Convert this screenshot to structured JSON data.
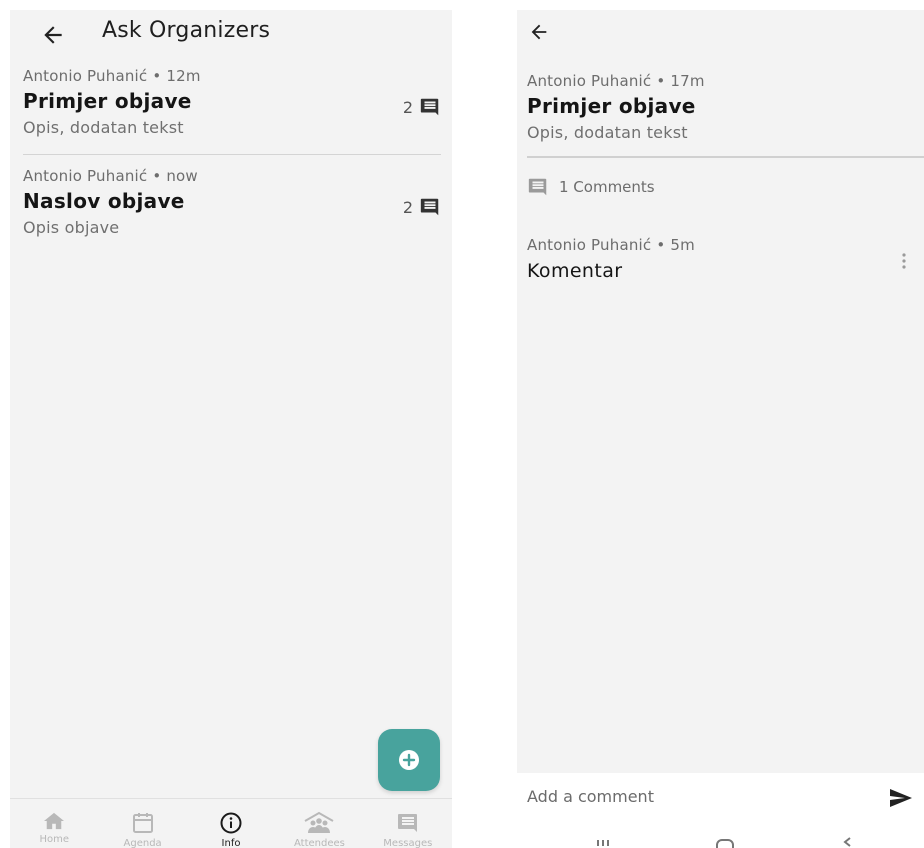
{
  "left": {
    "header": {
      "title": "Ask Organizers"
    },
    "posts": [
      {
        "author_time": "Antonio Puhanić • 12m",
        "title": "Primjer objave",
        "description": "Opis, dodatan tekst",
        "comment_count": "2"
      },
      {
        "author_time": "Antonio Puhanić • now",
        "title": "Naslov objave",
        "description": "Opis objave",
        "comment_count": "2"
      }
    ],
    "bottom_nav": [
      {
        "label": "Home",
        "icon": "home-icon",
        "active": false
      },
      {
        "label": "Agenda",
        "icon": "calendar-icon",
        "active": false
      },
      {
        "label": "Info",
        "icon": "info-icon",
        "active": true
      },
      {
        "label": "Attendees",
        "icon": "attendees-icon",
        "active": false
      },
      {
        "label": "Messages",
        "icon": "message-icon",
        "active": false
      }
    ]
  },
  "right": {
    "post": {
      "author_time": "Antonio Puhanić • 17m",
      "title": "Primjer objave",
      "description": "Opis, dodatan tekst"
    },
    "comments_label": "1 Comments",
    "comments": [
      {
        "author_time": "Antonio Puhanić • 5m",
        "text": "Komentar"
      }
    ],
    "input": {
      "placeholder": "Add a comment"
    }
  },
  "colors": {
    "accent": "#48a39d",
    "background": "#f3f3f3",
    "muted_text": "#6d6d6d",
    "icon_dark": "#333333",
    "nav_inactive": "#b8b8b8"
  }
}
